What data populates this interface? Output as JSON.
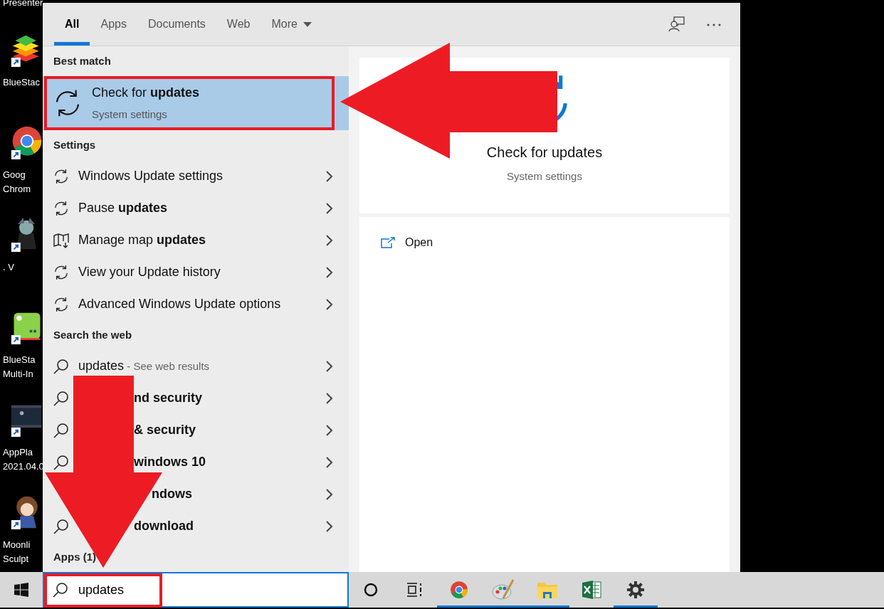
{
  "desktop": {
    "top_label": "Presenter",
    "icons": [
      {
        "kind": "layers",
        "lines": [
          "BlueStac"
        ]
      },
      {
        "kind": "ring",
        "lines": [
          "Goog",
          "Chrom"
        ]
      },
      {
        "kind": "figure",
        "lines": [
          ". V"
        ]
      },
      {
        "kind": "green-tile",
        "lines": [
          "BlueSta",
          "Multi-In"
        ]
      },
      {
        "kind": "video",
        "lines": [
          "AppPla",
          "2021.04.0"
        ]
      },
      {
        "kind": "doll",
        "lines": [
          "Moonli",
          "Sculpt"
        ]
      }
    ]
  },
  "search_panel": {
    "tabs": [
      {
        "label": "All",
        "selected": true,
        "kind": "plain"
      },
      {
        "label": "Apps",
        "selected": false,
        "kind": "plain"
      },
      {
        "label": "Documents",
        "selected": false,
        "kind": "plain"
      },
      {
        "label": "Web",
        "selected": false,
        "kind": "plain"
      },
      {
        "label": "More",
        "selected": false,
        "kind": "dropdown"
      }
    ],
    "sections": [
      {
        "heading": "Best match",
        "kind": "best",
        "items": [
          {
            "title": "Check for **updates**",
            "subtitle": "System settings",
            "selected": true
          }
        ]
      },
      {
        "heading": "Settings",
        "kind": "list",
        "items": [
          {
            "kind": "sync",
            "title": "Windows Update settings",
            "partial": false
          },
          {
            "kind": "sync",
            "title": "Pause **updates**",
            "partial": false
          },
          {
            "kind": "map",
            "title": "Manage map **updates**",
            "partial": false
          },
          {
            "kind": "sync",
            "title": "View your Update history",
            "partial": false
          },
          {
            "kind": "sync",
            "title": "Advanced Windows Update options",
            "partial": false
          }
        ]
      },
      {
        "heading": "Search the web",
        "kind": "list",
        "items": [
          {
            "kind": "search",
            "title": "updates",
            "note": " - See web results",
            "partial": false
          },
          {
            "kind": "search",
            "title": "**nd security**",
            "partial": true
          },
          {
            "kind": "search",
            "title": "**& security**",
            "partial": true
          },
          {
            "kind": "search",
            "title": "**windows 10**",
            "partial": true
          },
          {
            "kind": "covered",
            "title": "**ndows**",
            "partial": true
          },
          {
            "kind": "search",
            "title": "**download**",
            "partial": true
          }
        ]
      },
      {
        "heading": "Apps (1)",
        "kind": "heading"
      }
    ],
    "preview": {
      "title": "Check for updates",
      "subtitle": "System settings",
      "actions": [
        {
          "label": "Open"
        }
      ]
    }
  },
  "taskbar": {
    "search_value": "updates",
    "apps": [
      {
        "kind": "circle",
        "running": false
      },
      {
        "kind": "taskview",
        "running": false
      },
      {
        "kind": "browser",
        "running": true
      },
      {
        "kind": "paint",
        "running": true
      },
      {
        "kind": "folder",
        "running": true
      },
      {
        "kind": "sheet",
        "running": false
      },
      {
        "kind": "gear",
        "running": true
      }
    ]
  }
}
